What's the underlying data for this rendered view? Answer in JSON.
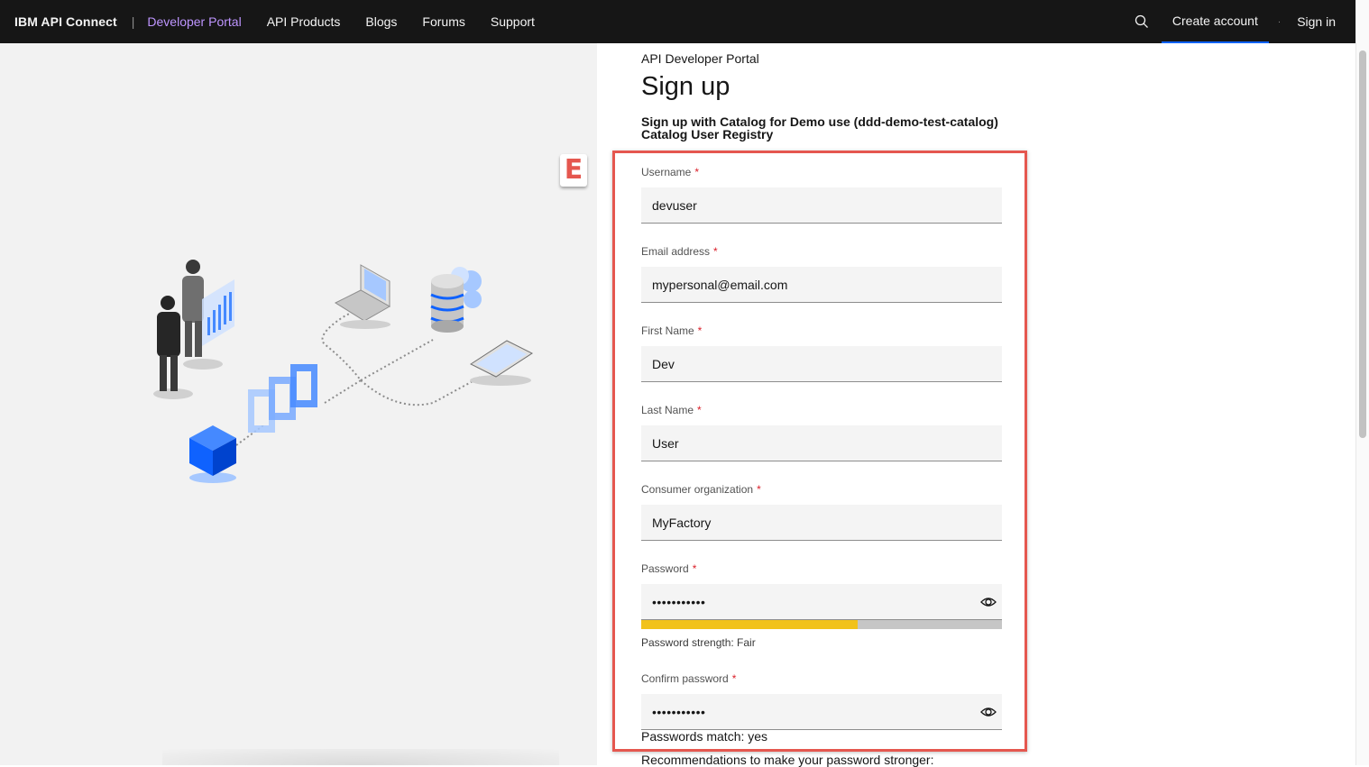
{
  "nav": {
    "brand": "IBM API Connect",
    "separator": "|",
    "links": [
      "Developer Portal",
      "API Products",
      "Blogs",
      "Forums",
      "Support"
    ],
    "create_account": "Create account",
    "sign_in": "Sign in",
    "dot": "·",
    "search_icon": "search-icon"
  },
  "page": {
    "portal_name": "API Developer Portal",
    "title": "Sign up",
    "subtitle": "Sign up with Catalog for Demo use (ddd-demo-test-catalog) Catalog User Registry"
  },
  "annotation": {
    "badge": "E",
    "color": "#e5574f"
  },
  "form": {
    "required_marker": "*",
    "username": {
      "label": "Username",
      "value": "devuser"
    },
    "email": {
      "label": "Email address",
      "value": "mypersonal@email.com"
    },
    "first_name": {
      "label": "First Name",
      "value": "Dev"
    },
    "last_name": {
      "label": "Last Name",
      "value": "User"
    },
    "consumer_org": {
      "label": "Consumer organization",
      "value": "MyFactory"
    },
    "password": {
      "label": "Password",
      "value": "•••••••••••",
      "strength_fraction": 0.6,
      "strength_text": "Password strength: Fair"
    },
    "confirm_password": {
      "label": "Confirm password",
      "value": "•••••••••••",
      "match_text": "Passwords match: yes"
    },
    "recommendations_text": "Recommendations to make your password stronger:"
  },
  "colors": {
    "nav_bg": "#161616",
    "active_link": "#be95ff",
    "accent": "#0f62fe",
    "strength_fair": "#f1c21b",
    "required": "#da1e28"
  }
}
